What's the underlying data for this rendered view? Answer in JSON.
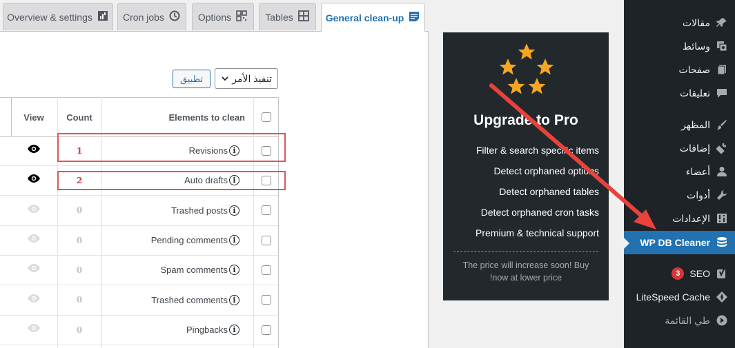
{
  "tabs": [
    {
      "label": "Overview & settings",
      "icon": "chart-icon"
    },
    {
      "label": "Cron jobs",
      "icon": "history-icon"
    },
    {
      "label": "Options",
      "icon": "qrcode-icon"
    },
    {
      "label": "Tables",
      "icon": "grid-icon"
    },
    {
      "label": "General clean-up",
      "icon": "document-icon",
      "active": true
    }
  ],
  "bulk": {
    "select_value": "تنفيذ الأمر",
    "apply_label": "تطبيق"
  },
  "table": {
    "headers": {
      "elements": "Elements to clean",
      "count": "Count",
      "view": "View"
    },
    "rows": [
      {
        "name": "Revisions",
        "count": "1",
        "has_items": true
      },
      {
        "name": "Auto drafts",
        "count": "2",
        "has_items": true
      },
      {
        "name": "Trashed posts",
        "count": "0",
        "has_items": false
      },
      {
        "name": "Pending comments",
        "count": "0",
        "has_items": false
      },
      {
        "name": "Spam comments",
        "count": "0",
        "has_items": false
      },
      {
        "name": "Trashed comments",
        "count": "0",
        "has_items": false
      },
      {
        "name": "Pingbacks",
        "count": "0",
        "has_items": false
      }
    ]
  },
  "promo": {
    "title": "Upgrade to Pro",
    "features": [
      "Filter & search specific items",
      "Detect orphaned options",
      "Detect orphaned tables",
      "Detect orphaned cron tasks",
      "Premium & technical support"
    ],
    "note": "The price will increase soon! Buy !now at lower price",
    "star_color": "#f5a623"
  },
  "admin_menu": {
    "items": [
      {
        "label": "مقالات",
        "icon": "pin-icon"
      },
      {
        "label": "وسائط",
        "icon": "media-icon"
      },
      {
        "label": "صفحات",
        "icon": "pages-icon"
      },
      {
        "label": "تعليقات",
        "icon": "comment-icon"
      },
      {
        "label": "المظهر",
        "icon": "brush-icon"
      },
      {
        "label": "إضافات",
        "icon": "plugin-icon"
      },
      {
        "label": "أعضاء",
        "icon": "user-icon"
      },
      {
        "label": "أدوات",
        "icon": "wrench-icon"
      },
      {
        "label": "الإعدادات",
        "icon": "settings-icon"
      },
      {
        "label": "WP DB Cleaner",
        "icon": "database-icon",
        "current": true
      },
      {
        "label": "SEO",
        "icon": "yoast-icon",
        "badge": "3"
      },
      {
        "label": "LiteSpeed Cache",
        "icon": "litespeed-icon"
      },
      {
        "label": "طي القائمة",
        "icon": "collapse-icon"
      }
    ]
  },
  "colors": {
    "accent": "#2271b1",
    "highlight_box": "#e05555",
    "annotation_arrow": "#e8423b"
  }
}
